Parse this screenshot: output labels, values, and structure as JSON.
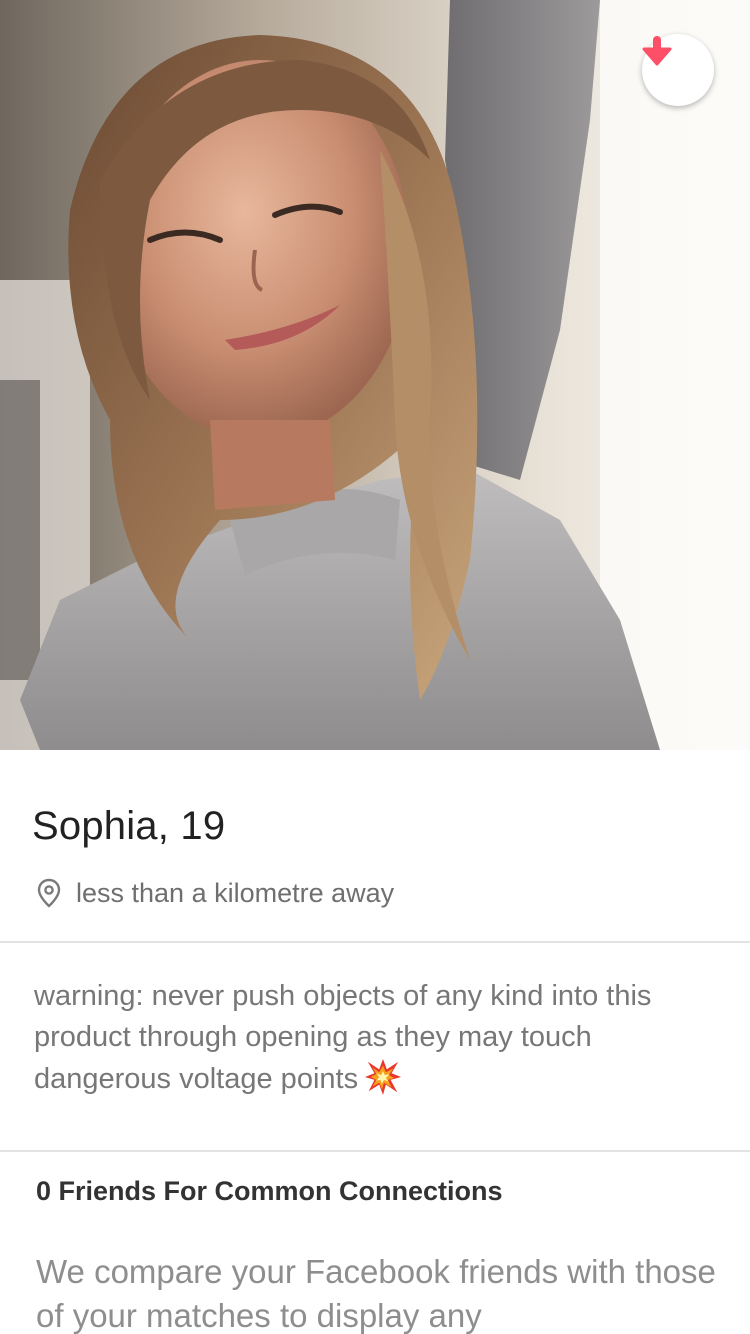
{
  "profile": {
    "name_age": "Sophia, 19",
    "distance": "less than a kilometre away",
    "bio": "warning: never push objects of any kind into this product through opening as they may touch dangerous voltage points"
  },
  "connections": {
    "title": "0 Friends For Common Connections",
    "description": "We compare your Facebook friends with those of your matches to display any"
  },
  "icons": {
    "collapse": "arrow-down-icon",
    "location": "location-pin-icon",
    "bio_emoji": "collision-emoji-icon"
  },
  "colors": {
    "accent": "#fd5068",
    "text_primary": "#222222",
    "text_secondary": "#777777",
    "divider": "#e3e3e3"
  }
}
